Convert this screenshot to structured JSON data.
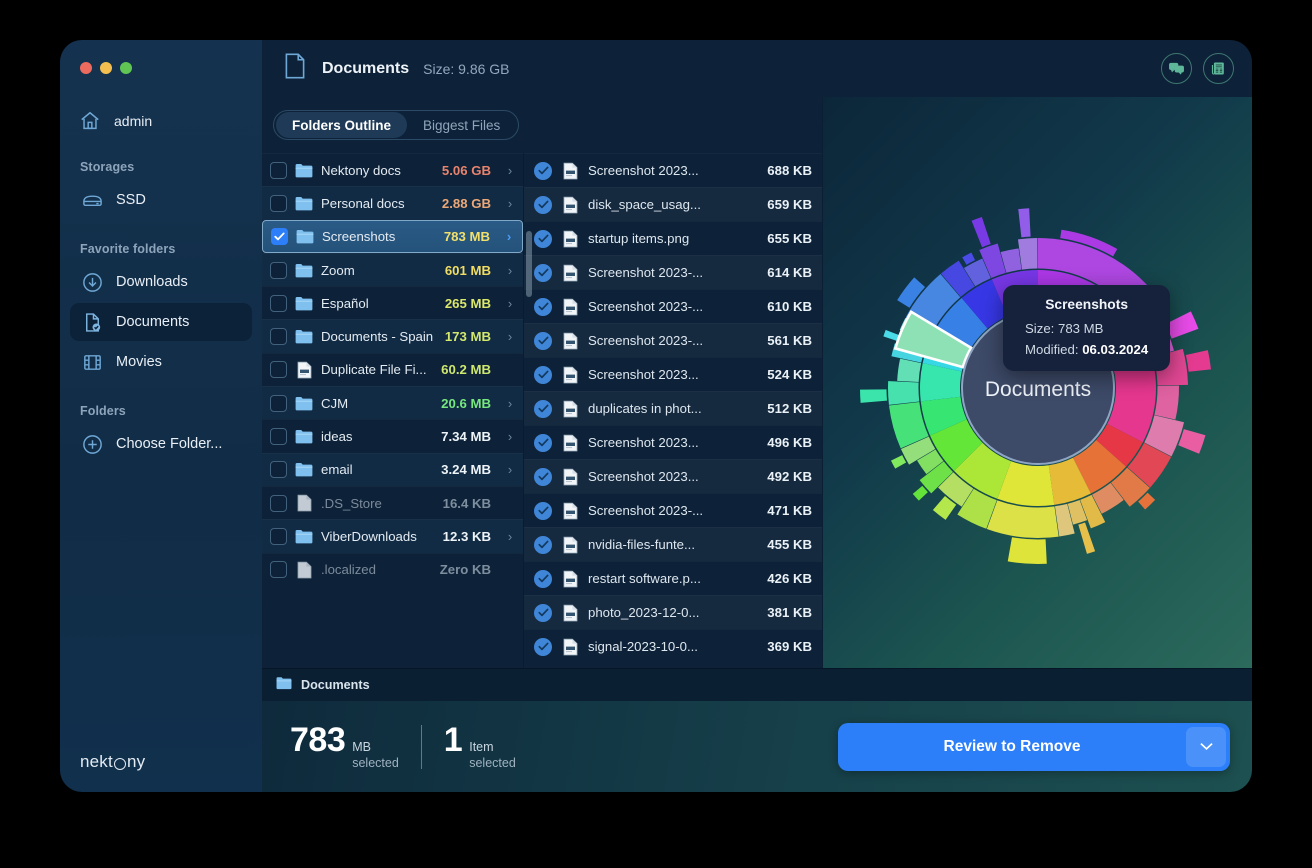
{
  "window": {
    "traffic_lights": [
      "close",
      "minimize",
      "zoom"
    ]
  },
  "sidebar": {
    "user": {
      "label": "admin",
      "icon": "home-icon"
    },
    "sections": [
      {
        "title": "Storages",
        "items": [
          {
            "label": "SSD",
            "icon": "drive-icon",
            "active": false
          }
        ]
      },
      {
        "title": "Favorite folders",
        "items": [
          {
            "label": "Downloads",
            "icon": "download-icon",
            "active": false
          },
          {
            "label": "Documents",
            "icon": "document-check-icon",
            "active": true
          },
          {
            "label": "Movies",
            "icon": "film-icon",
            "active": false
          }
        ]
      },
      {
        "title": "Folders",
        "items": [
          {
            "label": "Choose Folder...",
            "icon": "plus-circle-icon",
            "active": false
          }
        ]
      }
    ],
    "logo": {
      "part1": "nekt",
      "part2": "ny"
    }
  },
  "titlebar": {
    "icon": "document-icon",
    "title": "Documents",
    "size_label": "Size: 9.86 GB",
    "actions": [
      {
        "name": "chat-icon",
        "label": "Support chat"
      },
      {
        "name": "news-icon",
        "label": "News"
      }
    ]
  },
  "tabs": [
    {
      "label": "Folders Outline",
      "active": true
    },
    {
      "label": "Biggest Files",
      "active": false
    }
  ],
  "folders": [
    {
      "name": "Nektony docs",
      "size": "5.06 GB",
      "color": "#e8836d",
      "icon": "folder-icon",
      "checked": false,
      "selected": false,
      "chevron": true,
      "dim": false
    },
    {
      "name": "Personal docs",
      "size": "2.88 GB",
      "color": "#eda877",
      "icon": "folder-icon",
      "checked": false,
      "selected": false,
      "chevron": true,
      "dim": false
    },
    {
      "name": "Screenshots",
      "size": "783 MB",
      "color": "#f2e06a",
      "icon": "folder-icon",
      "checked": true,
      "selected": true,
      "chevron": true,
      "dim": false
    },
    {
      "name": "Zoom",
      "size": "601 MB",
      "color": "#f1dd63",
      "icon": "folder-icon",
      "checked": false,
      "selected": false,
      "chevron": true,
      "dim": false
    },
    {
      "name": "Español",
      "size": "265 MB",
      "color": "#dbe86a",
      "icon": "folder-icon",
      "checked": false,
      "selected": false,
      "chevron": true,
      "dim": false
    },
    {
      "name": "Documents - Spain",
      "size": "173 MB",
      "color": "#d3e86d",
      "icon": "folder-icon",
      "checked": false,
      "selected": false,
      "chevron": true,
      "dim": false
    },
    {
      "name": "Duplicate File Fi...",
      "size": "60.2 MB",
      "color": "#cfe76f",
      "icon": "file-icon",
      "checked": false,
      "selected": false,
      "chevron": false,
      "dim": false
    },
    {
      "name": "CJM",
      "size": "20.6 MB",
      "color": "#76e87e",
      "icon": "folder-icon",
      "checked": false,
      "selected": false,
      "chevron": true,
      "dim": false
    },
    {
      "name": "ideas",
      "size": "7.34 MB",
      "color": "#eef4f8",
      "icon": "folder-icon",
      "checked": false,
      "selected": false,
      "chevron": true,
      "dim": false
    },
    {
      "name": "email",
      "size": "3.24 MB",
      "color": "#eef4f8",
      "icon": "folder-icon",
      "checked": false,
      "selected": false,
      "chevron": true,
      "dim": false
    },
    {
      "name": ".DS_Store",
      "size": "16.4 KB",
      "color": "#7d8e9e",
      "icon": "file-gray-icon",
      "checked": false,
      "selected": false,
      "chevron": false,
      "dim": true
    },
    {
      "name": "ViberDownloads",
      "size": "12.3 KB",
      "color": "#eef4f8",
      "icon": "folder-icon",
      "checked": false,
      "selected": false,
      "chevron": true,
      "dim": false
    },
    {
      "name": ".localized",
      "size": "Zero KB",
      "color": "#7d8e9e",
      "icon": "file-gray-icon",
      "checked": false,
      "selected": false,
      "chevron": false,
      "dim": true
    }
  ],
  "files": [
    {
      "name": "Screenshot 2023...",
      "size": "688 KB",
      "checked": true
    },
    {
      "name": "disk_space_usag...",
      "size": "659 KB",
      "checked": true
    },
    {
      "name": "startup items.png",
      "size": "655 KB",
      "checked": true
    },
    {
      "name": "Screenshot 2023-...",
      "size": "614 KB",
      "checked": true
    },
    {
      "name": "Screenshot 2023-...",
      "size": "610 KB",
      "checked": true
    },
    {
      "name": "Screenshot 2023-...",
      "size": "561 KB",
      "checked": true
    },
    {
      "name": "Screenshot 2023...",
      "size": "524 KB",
      "checked": true
    },
    {
      "name": "duplicates in phot...",
      "size": "512 KB",
      "checked": true
    },
    {
      "name": "Screenshot 2023...",
      "size": "496 KB",
      "checked": true
    },
    {
      "name": "Screenshot 2023...",
      "size": "492 KB",
      "checked": true
    },
    {
      "name": "Screenshot 2023-...",
      "size": "471 KB",
      "checked": true
    },
    {
      "name": "nvidia-files-funte...",
      "size": "455 KB",
      "checked": true
    },
    {
      "name": "restart software.p...",
      "size": "426 KB",
      "checked": true
    },
    {
      "name": "photo_2023-12-0...",
      "size": "381 KB",
      "checked": true
    },
    {
      "name": "signal-2023-10-0...",
      "size": "369 KB",
      "checked": true
    }
  ],
  "chart": {
    "center_label": "Documents",
    "tooltip": {
      "title": "Screenshots",
      "size": "Size: 783 MB",
      "modified_label": "Modified: ",
      "modified_value": "06.03.2024"
    }
  },
  "chart_data": {
    "type": "pie",
    "title": "Documents disk usage sunburst",
    "center": "Documents",
    "total": "9.86 GB",
    "rings": 3,
    "highlighted_slice": "Screenshots",
    "categories": [
      "Nektony docs",
      "Personal docs",
      "Screenshots",
      "Zoom",
      "Español",
      "Documents - Spain",
      "Duplicate File Fi...",
      "CJM",
      "ideas",
      "email",
      ".DS_Store",
      "ViberDownloads",
      ".localized"
    ],
    "values": [
      5060,
      2880,
      783,
      601,
      265,
      173,
      60.2,
      20.6,
      7.34,
      3.24,
      0.0164,
      0.0123,
      0
    ],
    "units": "MB",
    "colors": [
      "#a855f7",
      "#ec4899",
      "#ef4444",
      "#f59e0b",
      "#fbbf24",
      "#a3e635",
      "#4ade80",
      "#34d399",
      "#5eead4",
      "#a7f3d0",
      "#3b82f6",
      "#2563eb",
      "#1d4ed8"
    ]
  },
  "pathbar": {
    "icon": "folder-icon",
    "label": "Documents"
  },
  "footer": {
    "size_number": "783",
    "size_unit": "MB",
    "size_caption": "selected",
    "items_number": "1",
    "items_unit": "Item",
    "items_caption": "selected",
    "cta_label": "Review to Remove",
    "cta_arrow": "chevron-down-icon"
  }
}
